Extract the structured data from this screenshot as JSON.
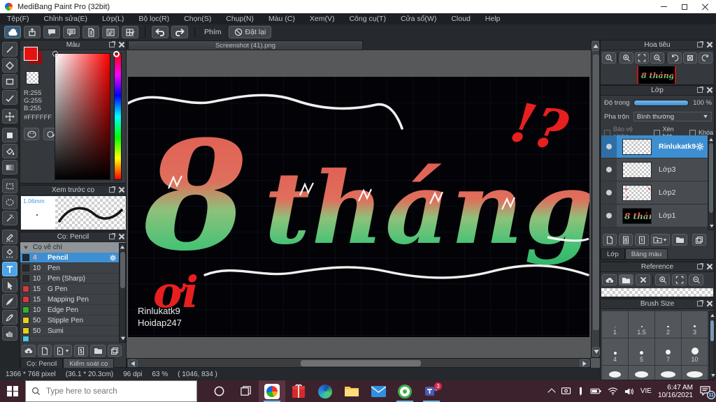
{
  "window": {
    "title": "MediBang Paint Pro (32bit)"
  },
  "menu": {
    "items": [
      "Tệp(F)",
      "Chỉnh sửa(E)",
      "Lớp(L)",
      "Bộ lọc(R)",
      "Chọn(S)",
      "Chụp(N)",
      "Màu (C)",
      "Xem(V)",
      "Công cụ(T)",
      "Cửa sổ(W)",
      "Cloud",
      "Help"
    ]
  },
  "toolbar": {
    "phim_label": "Phím",
    "reset_label": "Đặt lại"
  },
  "color_panel": {
    "title": "Màu",
    "r": "R:255",
    "g": "G:255",
    "b": "B:255",
    "hex": "#FFFFFF"
  },
  "brush_preview": {
    "title": "Xem trước cọ",
    "size": "1.06mm"
  },
  "brush_panel": {
    "title": "Cọ: Pencil",
    "group": "Cọ vẽ chì",
    "brushes": [
      {
        "size": "4",
        "name": "Pencil",
        "swatch": "#26282a"
      },
      {
        "size": "10",
        "name": "Pen",
        "swatch": "#26282a"
      },
      {
        "size": "10",
        "name": "Pen (Sharp)",
        "swatch": "#26282a"
      },
      {
        "size": "15",
        "name": "G Pen",
        "swatch": "#d93a3a"
      },
      {
        "size": "15",
        "name": "Mapping Pen",
        "swatch": "#d93a3a"
      },
      {
        "size": "10",
        "name": "Edge Pen",
        "swatch": "#2fb52f"
      },
      {
        "size": "50",
        "name": "Stipple Pen",
        "swatch": "#e3cf1e"
      },
      {
        "size": "50",
        "name": "Sumi",
        "swatch": "#e3cf1e"
      }
    ],
    "tabs": [
      "Cọ: Pencil",
      "Kiểm soát cọ"
    ]
  },
  "canvas": {
    "tab": "Screenshot (41).png",
    "art_8": "8",
    "art_thang": "tháng",
    "mark_top": "!?",
    "mark_bottom": "ơi",
    "sig1": "Rinlukatk9",
    "sig2": "Hoidap247",
    "text_gradient_top": "#e15a50",
    "text_gradient_bottom": "#2fb668",
    "mark_color": "#e81f1f"
  },
  "navigator_panel": {
    "title": "Hoa tiêu"
  },
  "layer_panel": {
    "title": "Lớp",
    "opacity_label": "Độ trong",
    "opacity_value": "100 %",
    "blend_label": "Pha trộn",
    "blend_value": "Bình thường",
    "cb_alpha": "Bảo vệ alpha",
    "cb_clip": "Xén bớt",
    "cb_lock": "Khóa",
    "layers": [
      {
        "name": "Rinlukatk9",
        "selected": true
      },
      {
        "name": "Lớp3"
      },
      {
        "name": "Lớp2"
      },
      {
        "name": "Lớp1"
      }
    ],
    "tabs": [
      "Lớp",
      "Bảng màu"
    ],
    "accent": "#3d8fd1"
  },
  "reference_panel": {
    "title": "Reference"
  },
  "brush_size_panel": {
    "title": "Brush Size",
    "sizes": [
      "1",
      "1.5",
      "2",
      "3",
      "4",
      "5",
      "7",
      "10"
    ]
  },
  "status_bar": {
    "dims": "1366 * 768 pixel",
    "cm": "(36.1 * 20.3cm)",
    "dpi": "96 dpi",
    "zoom": "63 %",
    "pos": "( 1046, 834 )"
  },
  "taskbar": {
    "search_placeholder": "Type here to search",
    "language": "VIE",
    "time": "6:47 AM",
    "date": "10/16/2021",
    "notif_badge": "11",
    "teams_badge": "3"
  }
}
